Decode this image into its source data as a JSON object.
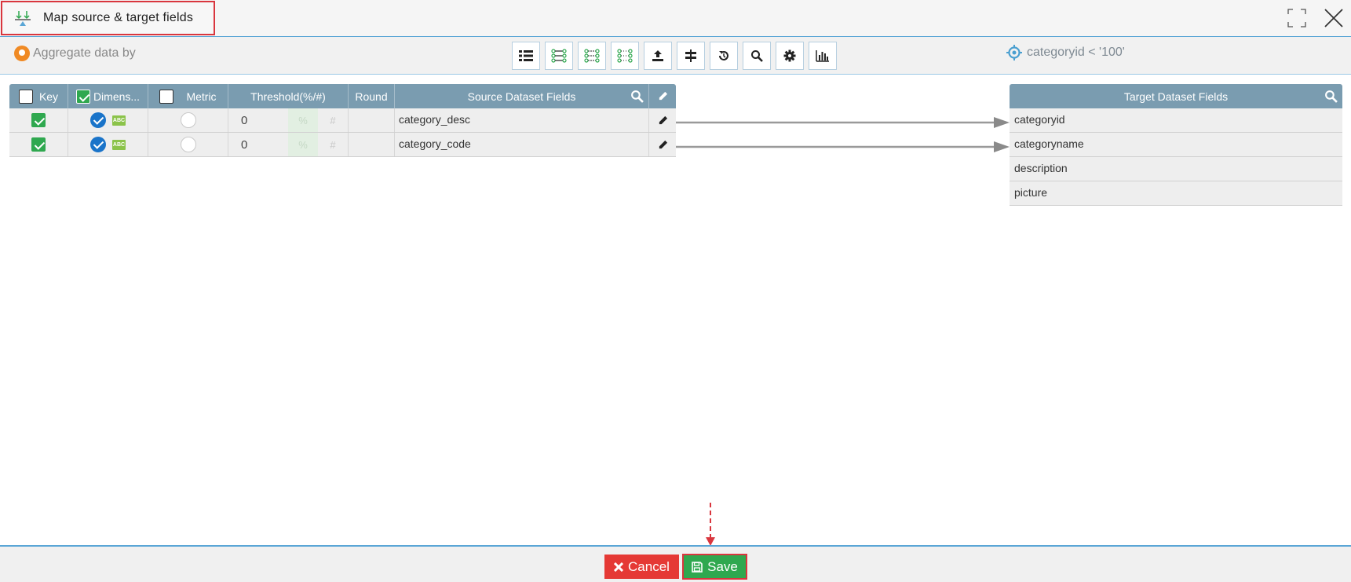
{
  "title": {
    "text": "Map source & target fields",
    "icon": "mapping-icon"
  },
  "window_controls": {
    "expand_icon": "expand-icon",
    "close_icon": "close-icon"
  },
  "aggregate": {
    "label": "Aggregate data by",
    "icon": "aggregate-toggle-icon"
  },
  "toolbar": {
    "icons": [
      "list-icon",
      "auto-map-icon",
      "map-by-name-icon",
      "map-by-position-icon",
      "upload-icon",
      "split-icon",
      "reset-icon",
      "search-icon",
      "settings-icon",
      "chart-icon"
    ]
  },
  "filter": {
    "text": "categoryid < '100'",
    "icon": "filter-target-icon"
  },
  "source_table": {
    "headers": {
      "key": "Key",
      "dimension": "Dimens...",
      "metric": "Metric",
      "threshold": "Threshold(%/#)",
      "round": "Round",
      "fields": "Source Dataset Fields"
    },
    "rows": [
      {
        "key": true,
        "dimension": true,
        "metric": false,
        "threshold": "0",
        "pct": "%",
        "hash": "#",
        "field": "category_desc",
        "type_badge": "ABC"
      },
      {
        "key": true,
        "dimension": true,
        "metric": false,
        "threshold": "0",
        "pct": "%",
        "hash": "#",
        "field": "category_code",
        "type_badge": "ABC"
      }
    ]
  },
  "target_table": {
    "header": "Target Dataset Fields",
    "rows": [
      "categoryid",
      "categoryname",
      "description",
      "picture"
    ]
  },
  "footer": {
    "cancel_label": "Cancel",
    "save_label": "Save"
  },
  "colors": {
    "header_bg": "#7a9cb0",
    "accent_blue": "#5aa6d6",
    "cancel_red": "#e53935",
    "save_green": "#2fa84f",
    "highlight_red": "#d9363e"
  }
}
